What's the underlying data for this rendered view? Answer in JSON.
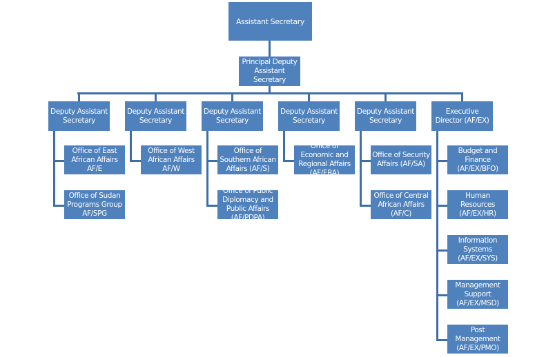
{
  "chart": {
    "top": {
      "label": "Assistant Secretary"
    },
    "principal": {
      "label": "Principal Deputy Assistant Secretary"
    },
    "branches": [
      {
        "label": "Deputy Assistant Secretary",
        "children": [
          {
            "label": "Office of East African Affairs AF/E"
          },
          {
            "label": "Office of Sudan Programs Group AF/SPG"
          }
        ]
      },
      {
        "label": "Deputy Assistant Secretary",
        "children": [
          {
            "label": "Office of West African Affairs AF/W"
          }
        ]
      },
      {
        "label": "Deputy Assistant Secretary",
        "children": [
          {
            "label": "Office of Southern African Affairs (AF/S)"
          },
          {
            "label": "Office of Public Diplomacy and Public Affairs (AF/PDPA)"
          }
        ]
      },
      {
        "label": "Deputy Assistant Secretary",
        "children": [
          {
            "label": "Office of Economic and Regional Affairs (AF/ERA)"
          }
        ]
      },
      {
        "label": "Deputy Assistant Secretary",
        "children": [
          {
            "label": "Office of Security Affairs (AF/SA)"
          },
          {
            "label": "Office of Central African Affairs (AF/C)"
          }
        ]
      },
      {
        "label": "Executive Director (AF/EX)",
        "children": [
          {
            "label": "Budget and Finance (AF/EX/BFO)"
          },
          {
            "label": "Human Resources (AF/EX/HR)"
          },
          {
            "label": "Information Systems (AF/EX/SYS)"
          },
          {
            "label": "Management Support (AF/EX/MSD)"
          },
          {
            "label": "Post Management (AF/EX/PMO)"
          }
        ]
      }
    ]
  },
  "colors": {
    "box": "#4f81bd",
    "line": "#3e6ea8",
    "text": "#ffffff"
  }
}
